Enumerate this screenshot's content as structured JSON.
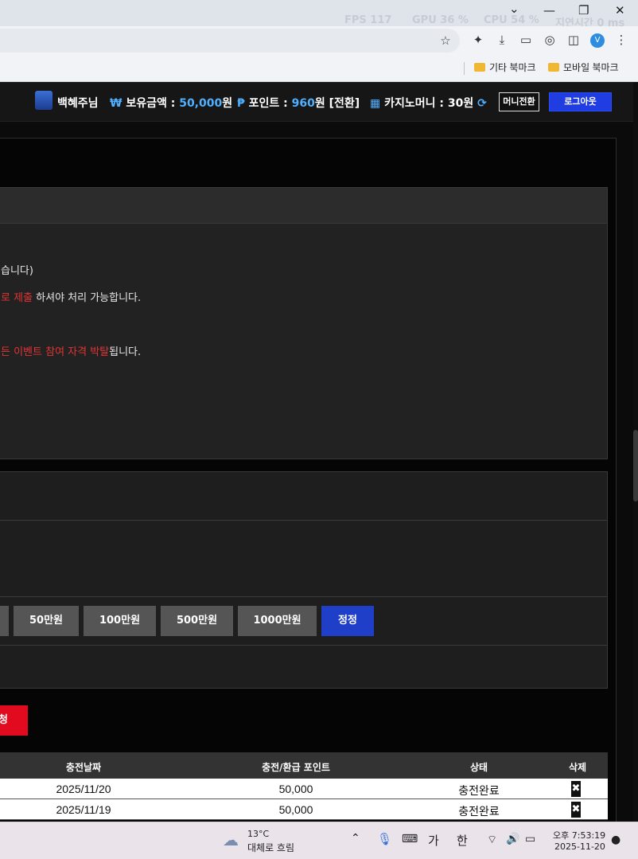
{
  "browser": {
    "overlay": {
      "fps": "FPS 117",
      "gpu": "GPU 36 %",
      "cpu": "CPU 54 %",
      "latency": "지연시간 0 ms"
    },
    "bookmarks": [
      "기타 북마크",
      "모바일 북마크"
    ],
    "profile_initial": "V"
  },
  "header": {
    "username": "백혜주님",
    "balance_label": "보유금액 :",
    "balance_value": "50,000",
    "balance_unit": "원",
    "point_label": "포인트 :",
    "point_value": "960",
    "point_unit": "원 [전환]",
    "casino_label": "카지노머니 :",
    "casino_value": "30원",
    "money_switch": "머니전환",
    "logout": "로그아웃"
  },
  "notice": {
    "line1": "습니다)",
    "line2_red": "로 제출",
    "line2_rest": " 하셔야 처리 가능합니다.",
    "line3_red": "든 이벤트 참여 자격 박탈",
    "line3_rest": "됩니다."
  },
  "amounts": [
    "50만원",
    "100만원",
    "500만원",
    "1000만원",
    "정정"
  ],
  "apply_button": "청",
  "table": {
    "headers": [
      "충전날짜",
      "충전/환급 포인트",
      "상태",
      "삭제"
    ],
    "rows": [
      {
        "date": "2025/11/20",
        "points": "50,000",
        "status": "충전완료",
        "delete": "✖"
      },
      {
        "date": "2025/11/19",
        "points": "50,000",
        "status": "충전완료",
        "delete": "✖"
      }
    ]
  },
  "taskbar": {
    "temp": "13°C",
    "weather": "대체로 흐림",
    "ime1": "가",
    "ime2": "한",
    "time": "오후 7:53:19",
    "date": "2025-11-20"
  }
}
